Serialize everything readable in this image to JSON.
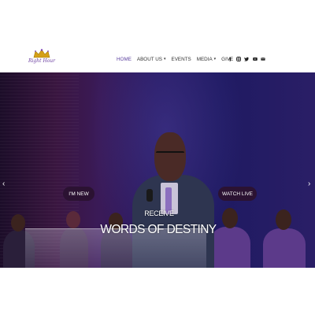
{
  "brand": {
    "logo_text": "Right Hour",
    "logo_icon": "crown-icon",
    "accent_color": "#5b3f9e"
  },
  "nav": {
    "items": [
      {
        "label": "HOME",
        "active": true,
        "dropdown": false
      },
      {
        "label": "ABOUT US",
        "active": false,
        "dropdown": true
      },
      {
        "label": "EVENTS",
        "active": false,
        "dropdown": false
      },
      {
        "label": "MEDIA",
        "active": false,
        "dropdown": true
      },
      {
        "label": "GIVE",
        "active": false,
        "dropdown": false
      }
    ]
  },
  "social": {
    "icons": [
      "facebook-icon",
      "instagram-icon",
      "twitter-icon",
      "youtube-icon",
      "email-icon"
    ]
  },
  "hero": {
    "subtitle": "RECEIVE",
    "title": "WORDS OF DESTINY",
    "left_button": "I'M NEW",
    "right_button": "WATCH LIVE",
    "prev_arrow": "‹",
    "next_arrow": "›"
  }
}
